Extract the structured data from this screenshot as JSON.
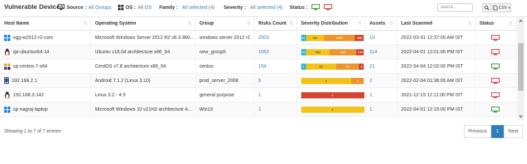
{
  "header": {
    "title": "Vulnerable Devices",
    "filters": [
      {
        "label": "Source :",
        "value": "All Groups",
        "icon": "monitor-icon"
      },
      {
        "label": "OS :",
        "value": "All OS",
        "icon": "os-grid-icon"
      },
      {
        "label": "Family :",
        "value": "All selected (4)"
      },
      {
        "label": "Severity :",
        "value": "All selected (4)"
      }
    ],
    "status_label": "Status :",
    "status_icons": [
      "status-online-icon",
      "status-offline-icon"
    ],
    "search_placeholder": "search...",
    "export_label": "CSV"
  },
  "table": {
    "columns": [
      "Host Name",
      "Operating System",
      "Group",
      "Risks Count",
      "Severity Distribution",
      "Assets",
      "Last Scanned",
      "Status"
    ],
    "rows": [
      {
        "host": "vgg-w2012-r2-com",
        "host_icon": "windows-icon",
        "os": "Microsoft Windows Server 2012 R2 v6.3.960...",
        "group": "windows server 2012 r2",
        "risks": "2503",
        "severity": [
          {
            "label": "51",
            "value": 51,
            "color": "#2fb3dc"
          },
          {
            "label": "781",
            "value": 781,
            "color": "#f2c318"
          },
          {
            "label": "1361",
            "value": 1361,
            "color": "#f0932b"
          },
          {
            "label": "390",
            "value": 390,
            "color": "#d64330"
          }
        ],
        "assets": "10",
        "last_scanned": "2022-03-31 12:37:00 AM IST",
        "status": "offline"
      },
      {
        "host": "qa-ubuntux64-14",
        "host_icon": "linux-icon",
        "os": "Ubuntu v18.04 architecture x86_64",
        "group": "new_group5",
        "risks": "1062",
        "severity": [
          {
            "label": "83",
            "value": 83,
            "color": "#2fb3dc"
          },
          {
            "label": "394",
            "value": 394,
            "color": "#f2c318"
          },
          {
            "label": "455",
            "value": 455,
            "color": "#f0932b"
          },
          {
            "label": "130",
            "value": 130,
            "color": "#d64330"
          }
        ],
        "assets": "114",
        "last_scanned": "2022-04-01 12:01:00 PM IST",
        "status": "offline"
      },
      {
        "host": "sp-centos-7-x64",
        "host_icon": "centos-icon",
        "os": "CentOS v7.8 architecture x86_64",
        "group": "centos",
        "risks": "154",
        "severity": [
          {
            "label": "4",
            "value": 4,
            "color": "#2fb3dc"
          },
          {
            "label": "83",
            "value": 83,
            "color": "#f2c318"
          },
          {
            "label": "62",
            "value": 62,
            "color": "#f0932b"
          },
          {
            "label": "5",
            "value": 5,
            "color": "#d64330"
          }
        ],
        "assets": "21",
        "last_scanned": "2022-04-04 12:02:00 PM IST",
        "status": "online"
      },
      {
        "host": "192.168.2.1",
        "host_icon": "android-phone-icon",
        "os": "Android 7.1.2 (Linux 3.10)",
        "group": "prod_server_2008",
        "risks": "5",
        "severity": [
          {
            "label": "4",
            "value": 4,
            "color": "#f2c318"
          },
          {
            "label": "1",
            "value": 1,
            "color": "#f0932b"
          }
        ],
        "assets": "2",
        "last_scanned": "2022-02-04 01:36:00 AM IST",
        "status": "offline"
      },
      {
        "host": "192.168.3.142",
        "host_icon": "linux-icon",
        "os": "Linux 3.2 - 4.9",
        "group": "general purpose",
        "risks": "1",
        "severity": [
          {
            "label": "1",
            "value": 1,
            "color": "#d64330"
          }
        ],
        "assets": "1",
        "last_scanned": "2021-12-15 12:11:00 PM IST",
        "status": "offline"
      },
      {
        "host": "sp-nagraj-laptop",
        "host_icon": "windows-icon",
        "os": "Microsoft Windows 10 v21H2 architecture A...",
        "group": "Win10",
        "risks": "1",
        "severity": [
          {
            "label": "1",
            "value": 1,
            "color": "#f2c318"
          }
        ],
        "assets": "1",
        "last_scanned": "2022-04-01 12:15:00 PM IST",
        "status": "online"
      }
    ]
  },
  "footer": {
    "summary": "Showing 1 to 7 of 7 entries",
    "previous": "Previous",
    "page": "1",
    "next": "Next"
  },
  "colors": {
    "link": "#2f7dbd",
    "online": "#2e9b2e",
    "offline": "#d93a3a"
  }
}
